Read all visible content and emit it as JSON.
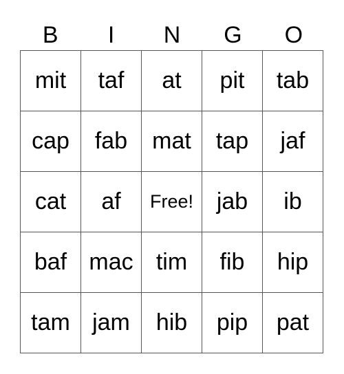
{
  "header": [
    "B",
    "I",
    "N",
    "G",
    "O"
  ],
  "rows": [
    [
      "mit",
      "taf",
      "at",
      "pit",
      "tab"
    ],
    [
      "cap",
      "fab",
      "mat",
      "tap",
      "jaf"
    ],
    [
      "cat",
      "af",
      "Free!",
      "jab",
      "ib"
    ],
    [
      "baf",
      "mac",
      "tim",
      "fib",
      "hip"
    ],
    [
      "tam",
      "jam",
      "hib",
      "pip",
      "pat"
    ]
  ]
}
